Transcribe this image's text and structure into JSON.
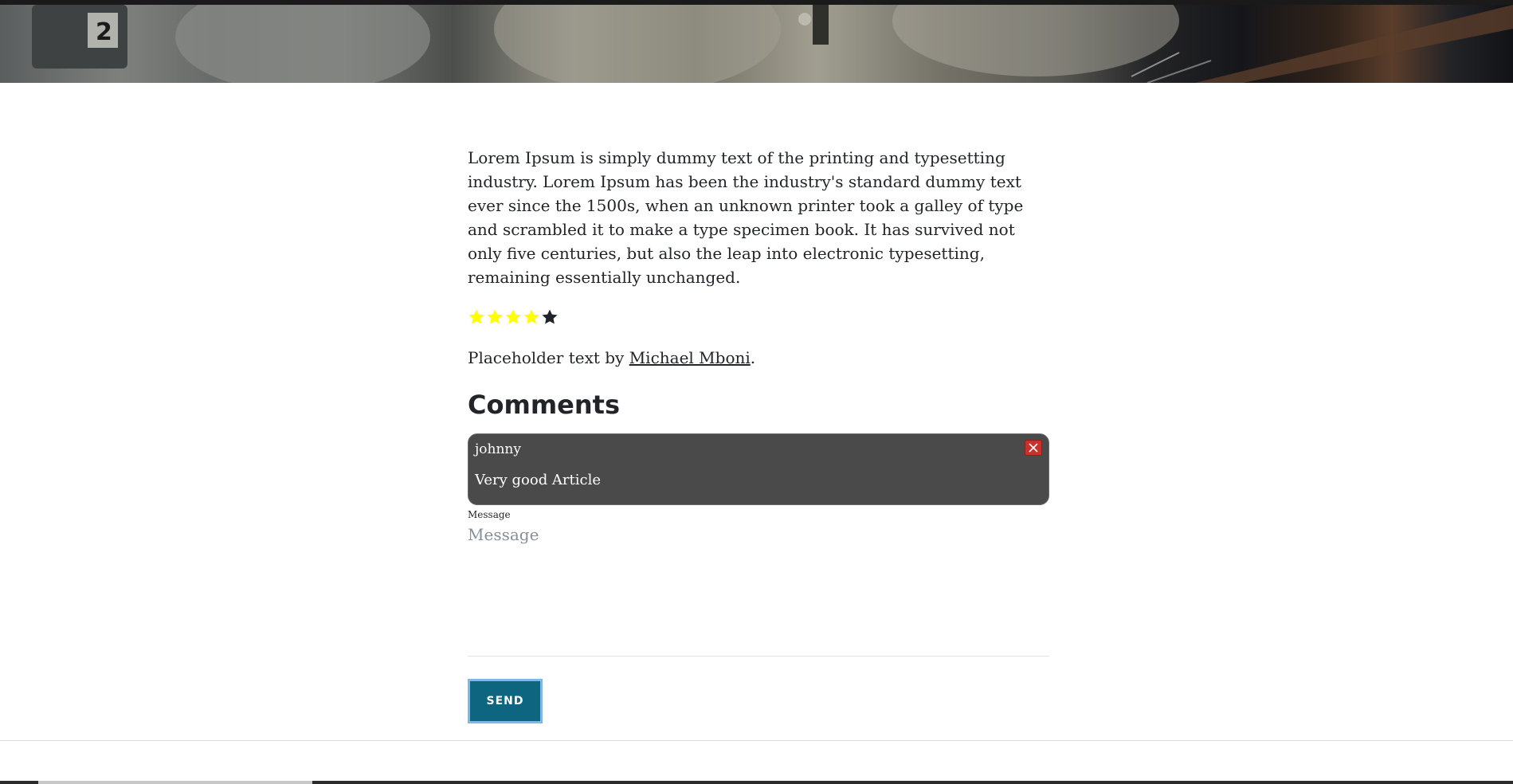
{
  "hero": {
    "image_alt": "astronaut-spacewalk-banner"
  },
  "article": {
    "body": "Lorem Ipsum is simply dummy text of the printing and typesetting industry. Lorem Ipsum has been the industry's standard dummy text ever since the 1500s, when an unknown printer took a galley of type and scrambled it to make a type specimen book. It has survived not only five centuries, but also the leap into electronic typesetting, remaining essentially unchanged.",
    "rating": {
      "value": 4,
      "max": 5,
      "filled_color": "#ffff00",
      "empty_color": "#212529"
    },
    "attribution_prefix": "Placeholder text by ",
    "attribution_author": "Michael Mboni",
    "attribution_suffix": "."
  },
  "comments": {
    "heading": "Comments",
    "items": [
      {
        "user": "johnny",
        "text": "Very good Article"
      }
    ]
  },
  "form": {
    "message_label": "Message",
    "message_placeholder": "Message",
    "send_label": "SEND"
  },
  "colors": {
    "send_button": "#0e6580",
    "comment_card": "#4a4a4a",
    "delete_button": "#c9302c"
  }
}
